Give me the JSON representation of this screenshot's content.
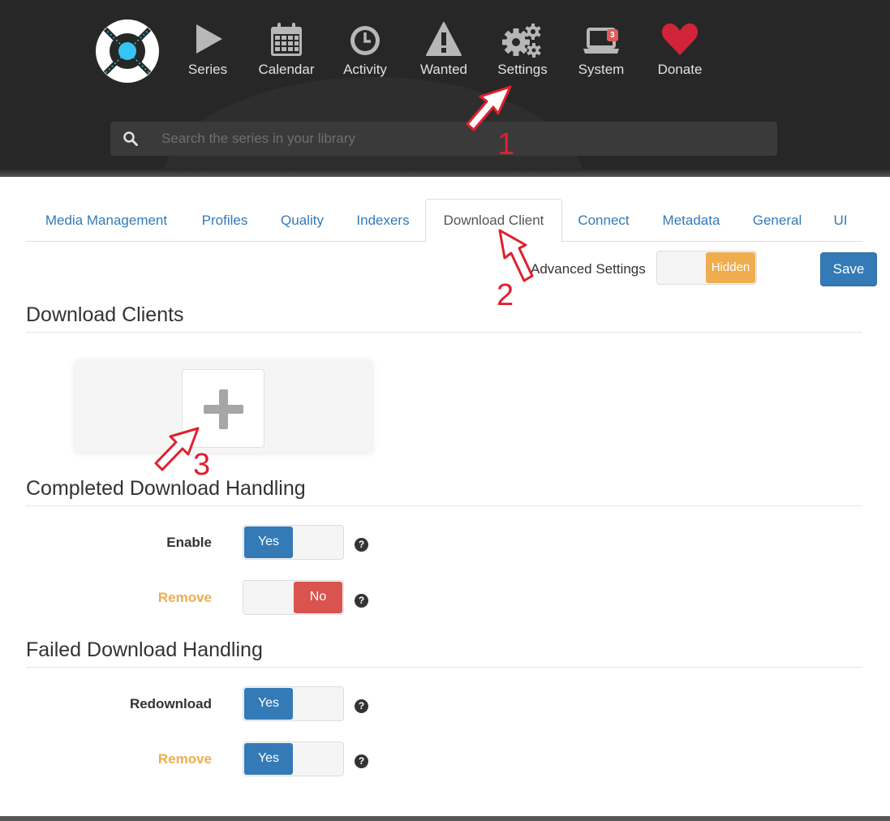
{
  "nav": {
    "items": [
      {
        "key": "series",
        "label": "Series",
        "icon": "play-icon"
      },
      {
        "key": "calendar",
        "label": "Calendar",
        "icon": "calendar-icon"
      },
      {
        "key": "activity",
        "label": "Activity",
        "icon": "clock-icon"
      },
      {
        "key": "wanted",
        "label": "Wanted",
        "icon": "warning-icon"
      },
      {
        "key": "settings",
        "label": "Settings",
        "icon": "gears-icon"
      },
      {
        "key": "system",
        "label": "System",
        "icon": "laptop-icon",
        "badge": "3"
      },
      {
        "key": "donate",
        "label": "Donate",
        "icon": "heart-icon"
      }
    ]
  },
  "search": {
    "placeholder": "Search the series in your library"
  },
  "tabs": [
    {
      "label": "Media Management"
    },
    {
      "label": "Profiles"
    },
    {
      "label": "Quality"
    },
    {
      "label": "Indexers"
    },
    {
      "label": "Download Client",
      "active": true
    },
    {
      "label": "Connect"
    },
    {
      "label": "Metadata"
    },
    {
      "label": "General"
    },
    {
      "label": "UI"
    }
  ],
  "toolbar": {
    "advanced_label": "Advanced Settings",
    "advanced_state": "Hidden",
    "save_label": "Save"
  },
  "sections": {
    "download_clients": "Download Clients",
    "completed": "Completed Download Handling",
    "failed": "Failed Download Handling"
  },
  "completed": {
    "enable": {
      "label": "Enable",
      "value": "Yes"
    },
    "remove": {
      "label": "Remove",
      "value": "No"
    }
  },
  "failed": {
    "redownload": {
      "label": "Redownload",
      "value": "Yes"
    },
    "remove": {
      "label": "Remove",
      "value": "Yes"
    }
  },
  "annotations": [
    "1",
    "2",
    "3"
  ],
  "colors": {
    "header_bg": "#272727",
    "link": "#337ab7",
    "primary": "#337ab7",
    "warning": "#f0ad4e",
    "danger": "#d9534f",
    "logo_accent": "#35c5f4",
    "heart": "#d0243a",
    "annotation": "#e0202e"
  }
}
